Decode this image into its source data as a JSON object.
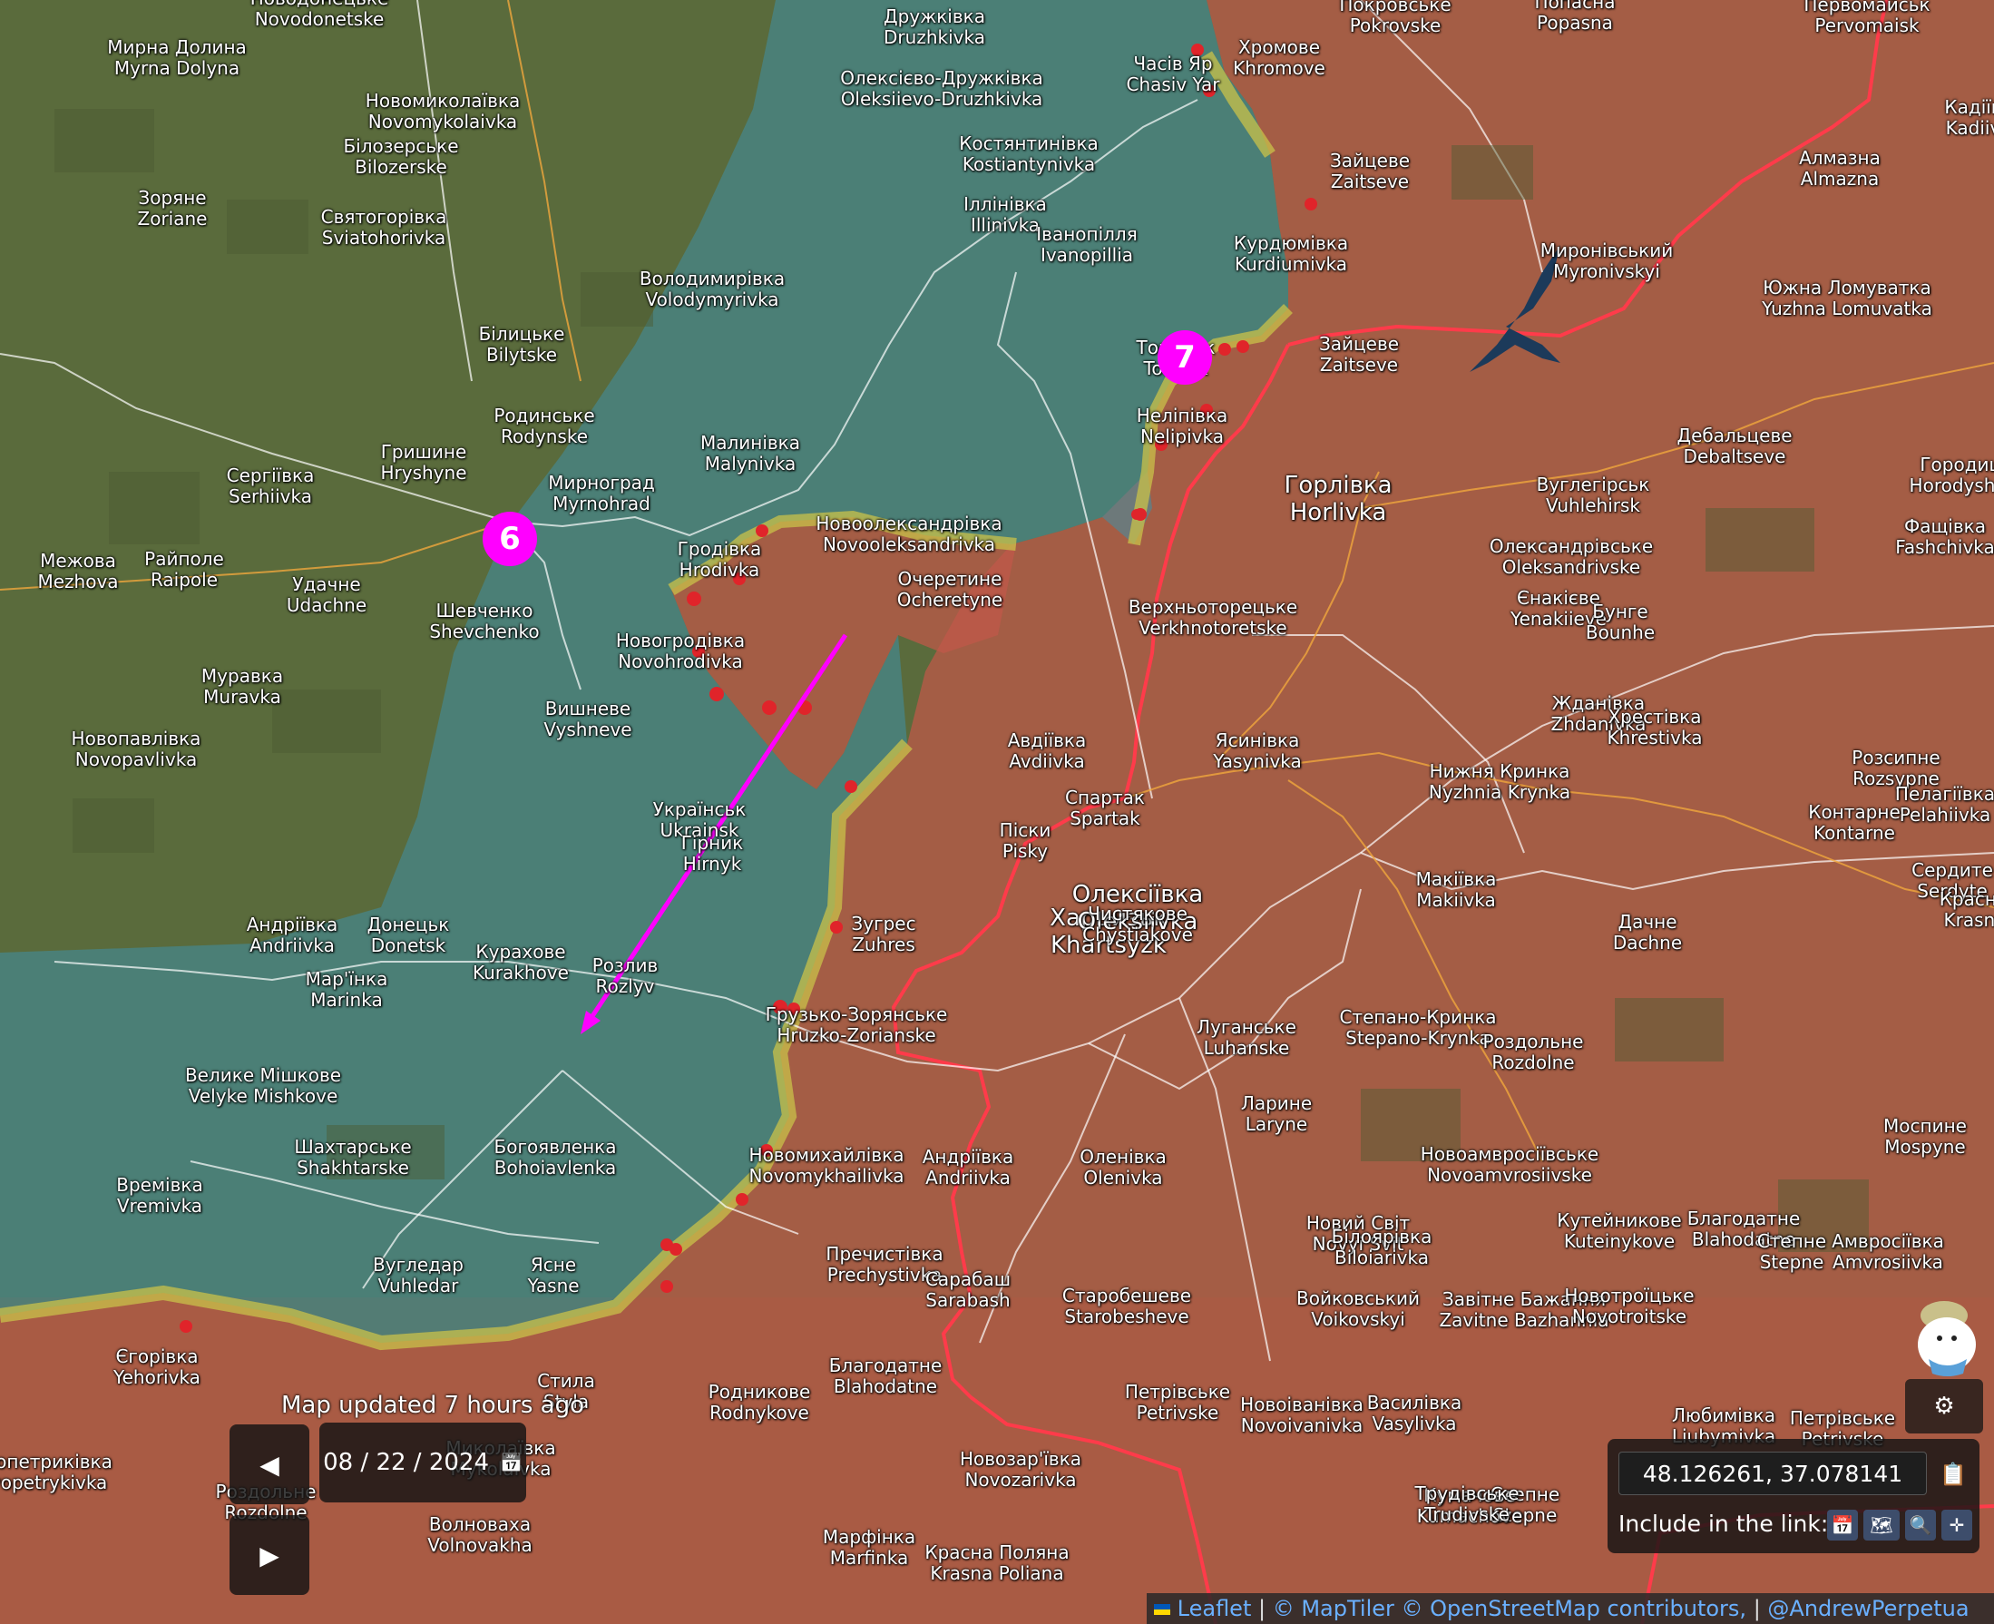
{
  "map": {
    "markers": [
      {
        "id": "6",
        "label": "6"
      },
      {
        "id": "7",
        "label": "7"
      }
    ],
    "colors": {
      "ukraine_controlled": "#3f8fa6",
      "occupied": "#c0574a",
      "contested": "#c9c24a",
      "front_line": "#ff3b4a",
      "attack_arrow": "#ff00ff",
      "marker": "#ff00ff",
      "roads": "#ffffff",
      "rail": "#f0a83c"
    },
    "towns": [
      {
        "uk": "Новодонецьке",
        "en": "Novodonetske"
      },
      {
        "uk": "Мирна Долина",
        "en": "Myrna Dolyna"
      },
      {
        "uk": "Новомиколаївка",
        "en": "Novomykolaivka"
      },
      {
        "uk": "Дружківка",
        "en": "Druzhkivka"
      },
      {
        "uk": "Олексієво-Дружківка",
        "en": "Oleksiievo-Druzhkivka"
      },
      {
        "uk": "Часів Яр",
        "en": "Chasiv Yar"
      },
      {
        "uk": "Хромове",
        "en": "Khromove"
      },
      {
        "uk": "Покровське",
        "en": "Pokrovske"
      },
      {
        "uk": "Попасна",
        "en": "Popasna"
      },
      {
        "uk": "Первомайськ",
        "en": "Pervomaisk"
      },
      {
        "uk": "Кадіїв",
        "en": "Kadiiv"
      },
      {
        "uk": "Білозерське",
        "en": "Bilozerske"
      },
      {
        "uk": "Костянтинівка",
        "en": "Kostiantynivka"
      },
      {
        "uk": "Зайцеве",
        "en": "Zaitseve"
      },
      {
        "uk": "Алмазна",
        "en": "Almazna"
      },
      {
        "uk": "Зоряне",
        "en": "Zoriane"
      },
      {
        "uk": "Святогорівка",
        "en": "Sviatohorivka"
      },
      {
        "uk": "Іллінівка",
        "en": "Illinivka"
      },
      {
        "uk": "Іванопілля",
        "en": "Ivanopillia"
      },
      {
        "uk": "Курдюмівка",
        "en": "Kurdiumivka"
      },
      {
        "uk": "Миронівський",
        "en": "Myronivskyi"
      },
      {
        "uk": "Володимирівка",
        "en": "Volodymyrivka"
      },
      {
        "uk": "Южна Ломуватка",
        "en": "Yuzhna Lomuvatka"
      },
      {
        "uk": "Білицьке",
        "en": "Bilytske"
      },
      {
        "uk": "Торецьк",
        "en": "Toretsk"
      },
      {
        "uk": "Зайцеве",
        "en": "Zaitseve"
      },
      {
        "uk": "Родинське",
        "en": "Rodynske"
      },
      {
        "uk": "Нелiпiвка",
        "en": "Nelipivka"
      },
      {
        "uk": "Дебальцеве",
        "en": "Debaltseve"
      },
      {
        "uk": "Гришине",
        "en": "Hryshyne"
      },
      {
        "uk": "Малинівка",
        "en": "Malynivka"
      },
      {
        "uk": "Сергіївка",
        "en": "Serhiivka"
      },
      {
        "uk": "Мирноград",
        "en": "Myrnohrad"
      },
      {
        "uk": "Горлівка",
        "en": "Horlivka"
      },
      {
        "uk": "Вуглегірськ",
        "en": "Vuhlehirsk"
      },
      {
        "uk": "Городище",
        "en": "Horodyshche"
      },
      {
        "uk": "Райполе",
        "en": "Raipole"
      },
      {
        "uk": "Новоолександрівка",
        "en": "Novooleksandrivka"
      },
      {
        "uk": "Гродівка",
        "en": "Hrodivka"
      },
      {
        "uk": "Фащівка",
        "en": "Fashchivka"
      },
      {
        "uk": "Межова",
        "en": "Mezhova"
      },
      {
        "uk": "Удачне",
        "en": "Udachne"
      },
      {
        "uk": "Олександрівське",
        "en": "Oleksandrivske"
      },
      {
        "uk": "Шевченко",
        "en": "Shevchenko"
      },
      {
        "uk": "Очеретине",
        "en": "Ocheretyne"
      },
      {
        "uk": "Єнакієве",
        "en": "Yenakiieve"
      },
      {
        "uk": "Бунге",
        "en": "Bounhe"
      },
      {
        "uk": "Верхньоторецьке",
        "en": "Verkhnotoretske"
      },
      {
        "uk": "Новогродівка",
        "en": "Novohrodivka"
      },
      {
        "uk": "Муравка",
        "en": "Muravka"
      },
      {
        "uk": "Жданівка",
        "en": "Zhdanivka"
      },
      {
        "uk": "Хрестівка",
        "en": "Khrestivka"
      },
      {
        "uk": "Вишневе",
        "en": "Vyshneve"
      },
      {
        "uk": "Новопавлівка",
        "en": "Novopavlivka"
      },
      {
        "uk": "Авдіївка",
        "en": "Avdiivka"
      },
      {
        "uk": "Ясинівка",
        "en": "Yasynivka"
      },
      {
        "uk": "Розсипне",
        "en": "Rozsypne"
      },
      {
        "uk": "Нижня Кринка",
        "en": "Nyzhnia Krynka"
      },
      {
        "uk": "Пелагіївка",
        "en": "Pelahiivka"
      },
      {
        "uk": "Українськ",
        "en": "Ukrainsk"
      },
      {
        "uk": "Спартак",
        "en": "Spartak"
      },
      {
        "uk": "Контарне",
        "en": "Kontarne"
      },
      {
        "uk": "Гірник",
        "en": "Hirnyk"
      },
      {
        "uk": "Піски",
        "en": "Pisky"
      },
      {
        "uk": "Макіївка",
        "en": "Makiivka"
      },
      {
        "uk": "Сердите",
        "en": "Serdyte"
      },
      {
        "uk": "Харцизьк",
        "en": "Khartsyzk"
      },
      {
        "uk": "Олексіївка",
        "en": "Oleksiivka"
      },
      {
        "uk": "Андріївка",
        "en": "Andriivka"
      },
      {
        "uk": "Донецьк",
        "en": "Donetsk"
      },
      {
        "uk": "Чистякове",
        "en": "Chystiakove"
      },
      {
        "uk": "Красногорівка",
        "en": "Krasnohorivka"
      },
      {
        "uk": "Зугрес",
        "en": "Zuhres"
      },
      {
        "uk": "Дачне",
        "en": "Dachne"
      },
      {
        "uk": "Курахове",
        "en": "Kurakhove"
      },
      {
        "uk": "Розлив",
        "en": "Rozlyv"
      },
      {
        "uk": "Мар'їнка",
        "en": "Marinka"
      },
      {
        "uk": "Грузько-Зорянське",
        "en": "Hruzko-Zorianske"
      },
      {
        "uk": "Степано-Кринка",
        "en": "Stepano-Krynka"
      },
      {
        "uk": "Роздольне",
        "en": "Rozdolne"
      },
      {
        "uk": "Луганське",
        "en": "Luhanske"
      },
      {
        "uk": "Ларине",
        "en": "Laryne"
      },
      {
        "uk": "Моспине",
        "en": "Mospyne"
      },
      {
        "uk": "Велике Мішкове",
        "en": "Velyke Mishkove"
      },
      {
        "uk": "Шахтарське",
        "en": "Shakhtarske"
      },
      {
        "uk": "Богоявленка",
        "en": "Bohoiavlenka"
      },
      {
        "uk": "Новомихайлівка",
        "en": "Novomykhailivka"
      },
      {
        "uk": "Андріївка",
        "en": "Andriivka"
      },
      {
        "uk": "Оленівка",
        "en": "Olenivka"
      },
      {
        "uk": "Новоамвросіївське",
        "en": "Novoamvrosiivske"
      },
      {
        "uk": "Времівка",
        "en": "Vremivka"
      },
      {
        "uk": "Новий Світ",
        "en": "Novyi Svit"
      },
      {
        "uk": "Кутейникове",
        "en": "Kuteinykove"
      },
      {
        "uk": "Благодатне",
        "en": "Blahodatne"
      },
      {
        "uk": "Степне",
        "en": "Stepne"
      },
      {
        "uk": "Амвросіївка",
        "en": "Amvrosiivka"
      },
      {
        "uk": "Білоярівка",
        "en": "Biloiarivka"
      },
      {
        "uk": "Пречистівка",
        "en": "Prechystivka"
      },
      {
        "uk": "Вугледар",
        "en": "Vuhledar"
      },
      {
        "uk": "Ясне",
        "en": "Yasne"
      },
      {
        "uk": "Сарабаш",
        "en": "Sarabash"
      },
      {
        "uk": "Старобешеве",
        "en": "Starobesheve"
      },
      {
        "uk": "Войковський",
        "en": "Voikovskyi"
      },
      {
        "uk": "Завітне Бажання",
        "en": "Zavitne Bazhannia"
      },
      {
        "uk": "Новотроїцьке",
        "en": "Novotroitske"
      },
      {
        "uk": "Єгорівка",
        "en": "Yehorivka"
      },
      {
        "uk": "Благодатне",
        "en": "Blahodatne"
      },
      {
        "uk": "Стила",
        "en": "Styla"
      },
      {
        "uk": "Родникове",
        "en": "Rodnykove"
      },
      {
        "uk": "Петрівське",
        "en": "Petrivske"
      },
      {
        "uk": "Новоіванівка",
        "en": "Novoivanivka"
      },
      {
        "uk": "Василівка",
        "en": "Vasylivka"
      },
      {
        "uk": "Любимівка",
        "en": "Liubymivka"
      },
      {
        "uk": "Петрівське",
        "en": "Petrivske"
      },
      {
        "uk": "Новопетриківка",
        "en": "Novopetrykivka"
      },
      {
        "uk": "Миколаївка",
        "en": "Mykolaivka"
      },
      {
        "uk": "Роздольне",
        "en": "Rozdolne"
      },
      {
        "uk": "Новозар'ївка",
        "en": "Novozarivka"
      },
      {
        "uk": "Степне",
        "en": "Stepne"
      },
      {
        "uk": "Кумачове",
        "en": "Kumachove"
      },
      {
        "uk": "Волноваха",
        "en": "Volnovakha"
      },
      {
        "uk": "Трудівське",
        "en": "Trudivske"
      },
      {
        "uk": "Марфінка",
        "en": "Marfinka"
      },
      {
        "uk": "Красна Поляна",
        "en": "Krasna Poliana"
      }
    ]
  },
  "controls": {
    "updated_text": "Map updated 7 hours ago",
    "prev_icon": "◀",
    "next_icon": "▶",
    "date_value": "08 / 22 / 2024",
    "calendar_icon": "📅"
  },
  "coords": {
    "value": "48.126261, 37.078141",
    "copy_icon": "📋",
    "include_label": "Include in the link:",
    "options": [
      "📅",
      "🗺",
      "🔍",
      "✛"
    ]
  },
  "attribution": {
    "leaflet": "Leaflet",
    "maptiler": "© MapTiler",
    "osm": "© OpenStreetMap contributors,",
    "author": "@AndrewPerpetua",
    "flag_icon": "ukraine-flag-icon"
  },
  "mascot": {
    "icon": "settings-gear-icon",
    "gear_glyph": "⚙"
  }
}
